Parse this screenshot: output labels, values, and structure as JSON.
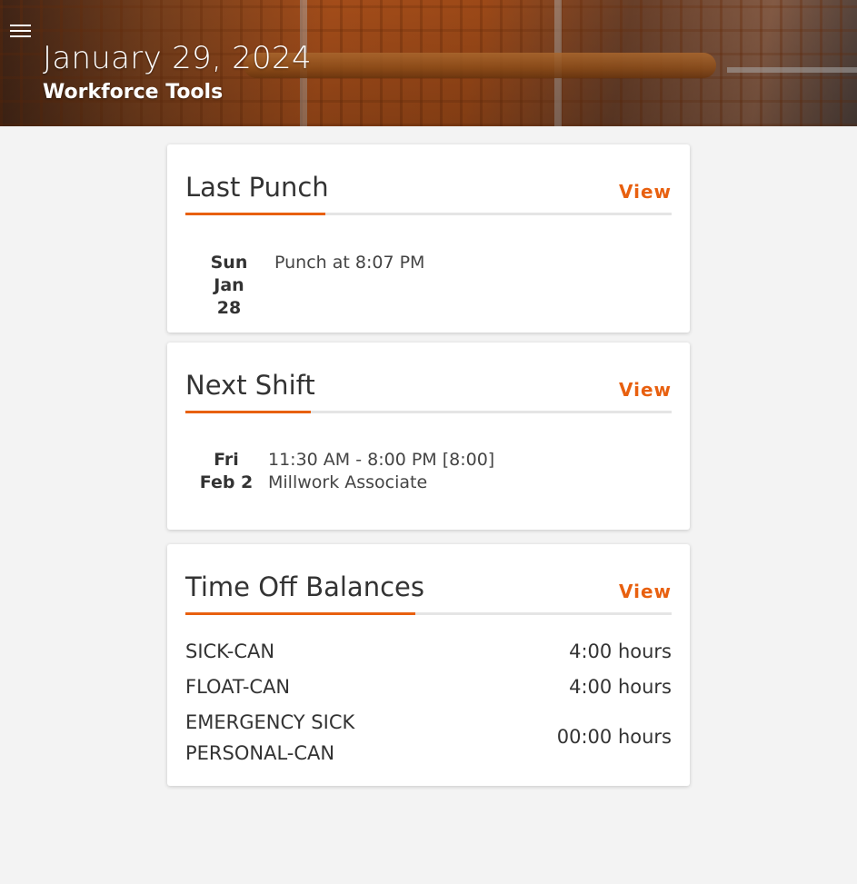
{
  "header": {
    "date": "January 29, 2024",
    "subtitle": "Workforce Tools"
  },
  "colors": {
    "accent": "#e8600f",
    "background": "#f3f3f3",
    "card": "#ffffff"
  },
  "last_punch": {
    "title": "Last Punch",
    "view_label": "View",
    "day": "Sun",
    "date": "Jan 28",
    "detail": "Punch at 8:07 PM"
  },
  "next_shift": {
    "title": "Next Shift",
    "view_label": "View",
    "day": "Fri",
    "date": "Feb 2",
    "time": "11:30 AM - 8:00 PM [8:00]",
    "role": "Millwork Associate"
  },
  "time_off": {
    "title": "Time Off Balances",
    "view_label": "View",
    "balances": [
      {
        "name": "SICK-CAN",
        "value": "4:00 hours"
      },
      {
        "name": "FLOAT-CAN",
        "value": "4:00 hours"
      },
      {
        "name_line1": "EMERGENCY SICK",
        "name_line2": "PERSONAL-CAN",
        "value": "00:00 hours"
      }
    ]
  }
}
